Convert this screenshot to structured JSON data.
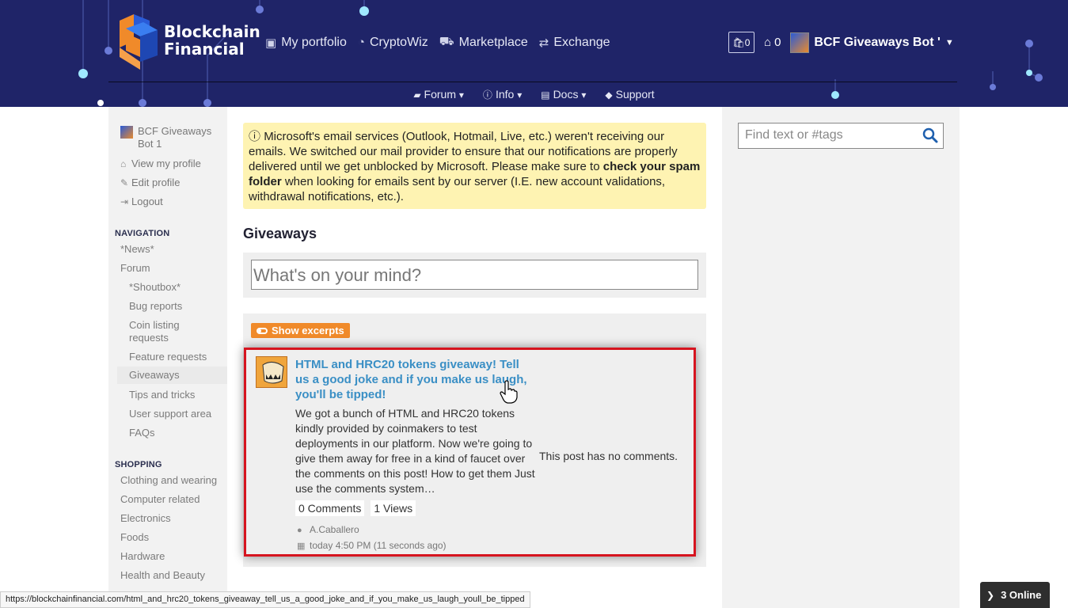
{
  "brand": {
    "line1": "Blockchain",
    "line2": "Financial"
  },
  "topnav": [
    {
      "label": "My portfolio",
      "icon": "briefcase-icon"
    },
    {
      "label": "CryptoWiz",
      "icon": "gauge-icon"
    },
    {
      "label": "Marketplace",
      "icon": "cart-icon"
    },
    {
      "label": "Exchange",
      "icon": "exchange-icon"
    }
  ],
  "userbar": {
    "cart_count": "0",
    "inbox_count": "0",
    "name": "BCF Giveaways Bot '"
  },
  "subnav": [
    {
      "label": "Forum",
      "icon": "folder-icon",
      "caret": true
    },
    {
      "label": "Info",
      "icon": "info-icon",
      "caret": true
    },
    {
      "label": "Docs",
      "icon": "book-icon",
      "caret": true
    },
    {
      "label": "Support",
      "icon": "tag-icon",
      "caret": false
    }
  ],
  "sidebar": {
    "user": "BCF Giveaways Bot 1",
    "links": [
      "View my profile",
      "Edit profile",
      "Logout"
    ],
    "navigation_title": "NAVIGATION",
    "navigation": [
      "*News*",
      "Forum",
      "*Shoutbox*",
      "Bug reports",
      "Coin listing requests",
      "Feature requests",
      "Giveaways",
      "Tips and tricks",
      "User support area",
      "FAQs"
    ],
    "shopping_title": "SHOPPING",
    "shopping": [
      "Clothing and wearing",
      "Computer related",
      "Electronics",
      "Foods",
      "Hardware",
      "Health and Beauty"
    ]
  },
  "notice": {
    "text1": "Microsoft's email services (Outlook, Hotmail, Live, etc.) weren't receiving our emails. We switched our mail provider to ensure that our notifications are properly delivered until we get unblocked by Microsoft. Please make sure to ",
    "bold": "check your spam folder",
    "text2": " when looking for emails sent by our server (I.E. new account validations, withdrawal notifications, etc.)."
  },
  "section_title": "Giveaways",
  "composer_placeholder": "What's on your mind?",
  "excerpts_button": "Show excerpts",
  "post": {
    "title": "HTML and HRC20 tokens giveaway! Tell us a good joke and if you make us laugh, you'll be tipped!",
    "excerpt": "We got a bunch of HTML and HRC20 tokens kindly provided by coinmakers to test deployments in our platform. Now we're going to give them away for free in a kind of faucet over the comments on this post! How to get them Just use the comments system…",
    "no_comments": "This post has no comments.",
    "comments": "0 Comments",
    "views": "1 Views",
    "author": "A.Caballero",
    "date": "today 4:50 PM (11 seconds ago)"
  },
  "search_placeholder": "Find text or #tags",
  "status_url": "https://blockchainfinancial.com/html_and_hrc20_tokens_giveaway_tell_us_a_good_joke_and_if_you_make_us_laugh_youll_be_tipped",
  "online": "3 Online"
}
